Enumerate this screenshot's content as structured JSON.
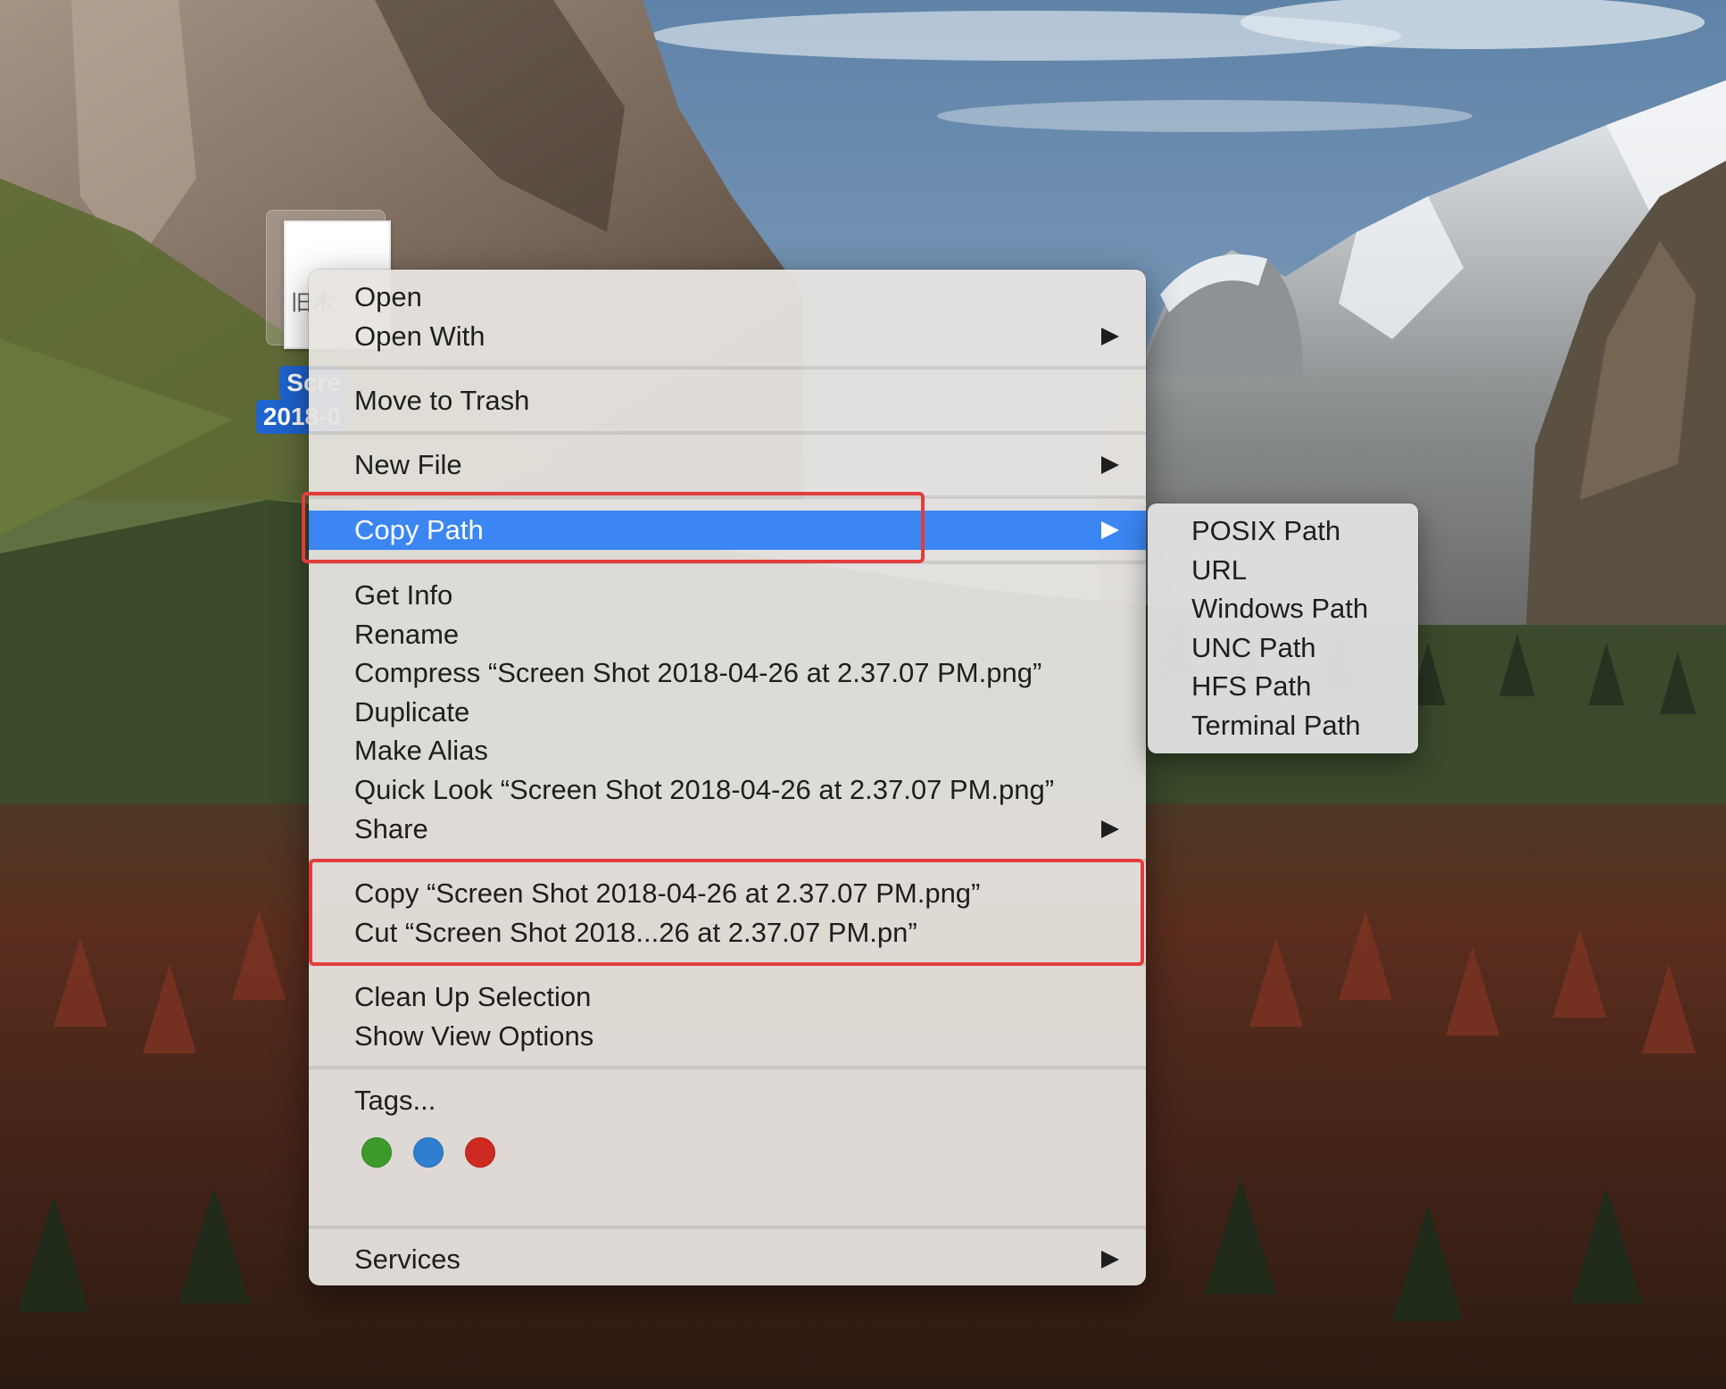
{
  "desktop": {
    "file_label_line1": "Scre",
    "file_label_line2": "2018-0",
    "file_thumb_text": "旧木"
  },
  "context_menu": {
    "items": [
      {
        "label": "Open",
        "has_submenu": false
      },
      {
        "label": "Open With",
        "has_submenu": true
      },
      {
        "label": "Move to Trash",
        "has_submenu": false
      },
      {
        "label": "New File",
        "has_submenu": true
      },
      {
        "label": "Copy Path",
        "has_submenu": true,
        "highlighted": true
      },
      {
        "label": "Get Info",
        "has_submenu": false
      },
      {
        "label": "Rename",
        "has_submenu": false
      },
      {
        "label": "Compress “Screen Shot 2018-04-26 at 2.37.07 PM.png”",
        "has_submenu": false
      },
      {
        "label": "Duplicate",
        "has_submenu": false
      },
      {
        "label": "Make Alias",
        "has_submenu": false
      },
      {
        "label": "Quick Look “Screen Shot 2018-04-26 at 2.37.07 PM.png”",
        "has_submenu": false
      },
      {
        "label": "Share",
        "has_submenu": true
      },
      {
        "label": "Copy “Screen Shot 2018-04-26 at 2.37.07 PM.png”",
        "has_submenu": false
      },
      {
        "label": "Cut “Screen Shot 2018...26 at 2.37.07 PM.pn”",
        "has_submenu": false
      },
      {
        "label": "Clean Up Selection",
        "has_submenu": false
      },
      {
        "label": "Show View Options",
        "has_submenu": false
      },
      {
        "label": "Tags...",
        "has_submenu": false
      },
      {
        "label": "Services",
        "has_submenu": true
      }
    ],
    "tags": [
      {
        "name": "green-tag",
        "color": "#3c9a2a"
      },
      {
        "name": "blue-tag",
        "color": "#2f7fd0"
      },
      {
        "name": "red-tag",
        "color": "#cf2a21"
      }
    ]
  },
  "copy_path_submenu": {
    "items": [
      "POSIX Path",
      "URL",
      "Windows Path",
      "UNC Path",
      "HFS Path",
      "Terminal Path"
    ]
  },
  "colors": {
    "highlight": "#3b86f3",
    "annotation": "#e23d3d",
    "file_label_bg": "#1e63cf"
  }
}
